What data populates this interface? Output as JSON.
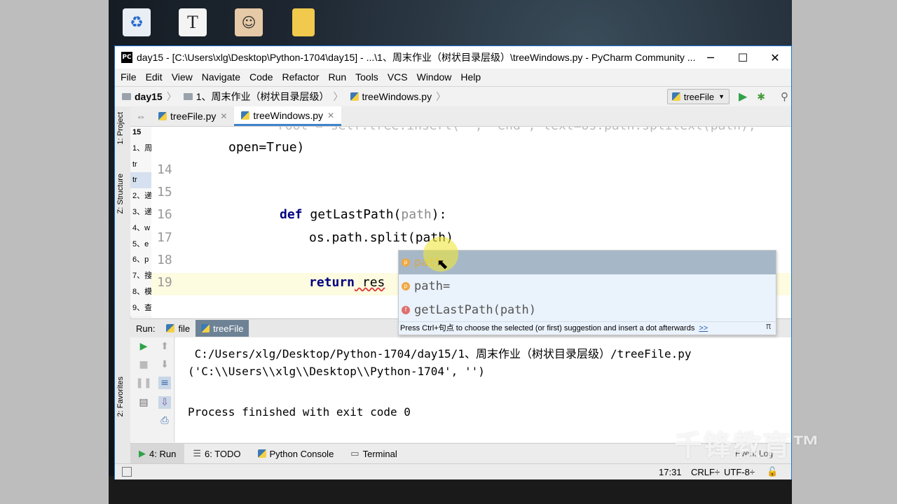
{
  "window": {
    "title": "day15 - [C:\\Users\\xlg\\Desktop\\Python-1704\\day15] - ...\\1、周末作业（树状目录层级）\\treeWindows.py - PyCharm Community ...",
    "minimize": "─",
    "maximize": "☐",
    "close": "✕"
  },
  "menu": [
    "File",
    "Edit",
    "View",
    "Navigate",
    "Code",
    "Refactor",
    "Run",
    "Tools",
    "VCS",
    "Window",
    "Help"
  ],
  "breadcrumb": {
    "project": "day15",
    "folder": "1、周末作业（树状目录层级）",
    "file": "treeWindows.py"
  },
  "run_config": "treeFile",
  "side_tabs": {
    "project": "1: Project",
    "structure": "Z: Structure",
    "favorites": "2: Favorites"
  },
  "project_tree": [
    "15",
    "1、周",
    "tr",
    "tr",
    "2、递",
    "3、递",
    "4、w",
    "5、e",
    "6、p",
    "7、搜",
    "8、模",
    "9、查"
  ],
  "editor_tabs": [
    {
      "label": "treeFile.py",
      "close": "✕"
    },
    {
      "label": "treeWindows.py",
      "close": "✕"
    }
  ],
  "code": {
    "line13_tail": "open=True)",
    "line13_head": "root = self.tree.insert(\"\", \"end\", text=os.path.splitext(path),",
    "lines": [
      {
        "num": "14",
        "text": ""
      },
      {
        "num": "15",
        "text": ""
      },
      {
        "num": "16",
        "kw": "def",
        "name": " getLastPath(",
        "param": "path",
        "end": "):"
      },
      {
        "num": "17",
        "text": "os.path.split(path)"
      },
      {
        "num": "18",
        "text": ""
      },
      {
        "num": "19",
        "kw": "return",
        "rest": " res"
      }
    ]
  },
  "autocomplete": {
    "items": [
      {
        "badge": "p",
        "label": "path"
      },
      {
        "badge": "p",
        "label": "path="
      },
      {
        "badge": "f",
        "label": "getLastPath(path)"
      }
    ],
    "hint": "Press Ctrl+句点 to choose the selected (or first) suggestion and insert a dot afterwards",
    "hint_link": ">>",
    "pi": "π"
  },
  "run_panel": {
    "label": "Run:",
    "tabs": [
      "file",
      "treeFile"
    ],
    "output": [
      " C:/Users/xlg/Desktop/Python-1704/day15/1、周末作业（树状目录层级）/treeFile.py",
      "('C:\\\\Users\\\\xlg\\\\Desktop\\\\Python-1704', '')",
      "",
      "Process finished with exit code 0"
    ]
  },
  "bottom_tabs": [
    "4: Run",
    "6: TODO",
    "Python Console",
    "Terminal"
  ],
  "event_log": "Event Log",
  "status": {
    "position": "17:31",
    "line_sep": "CRLF÷",
    "encoding": "UTF-8÷"
  },
  "watermark": "千锋教育™",
  "colors": {
    "keyword": "#000080",
    "selection": "#a6b8c8",
    "accent": "#4083c9"
  }
}
